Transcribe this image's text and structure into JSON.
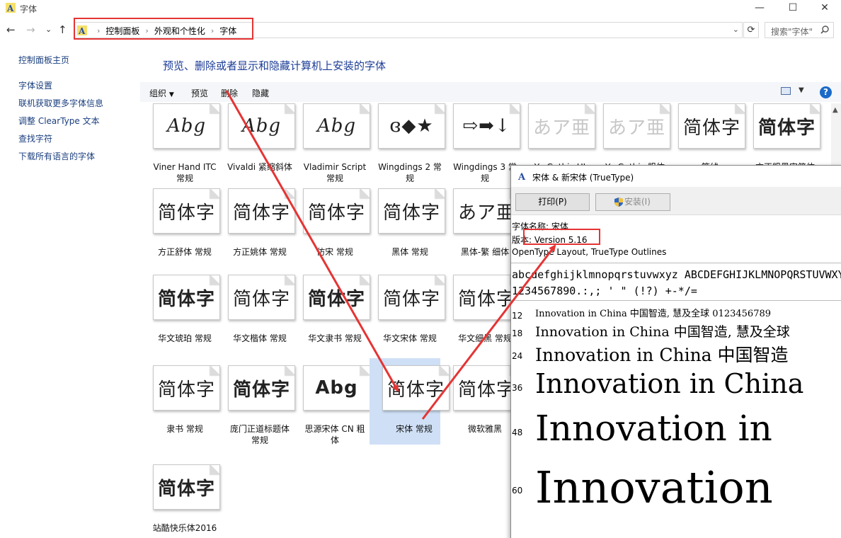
{
  "window": {
    "title": "字体",
    "min_glyph": "—",
    "max_glyph": "☐",
    "close_glyph": "✕"
  },
  "nav": {
    "back_glyph": "←",
    "forward_glyph": "→",
    "history_glyph": "⌄",
    "up_glyph": "↑"
  },
  "address": {
    "crumbs": [
      "控制面板",
      "外观和个性化",
      "字体"
    ],
    "sep_glyph": "›",
    "dropdown_glyph": "⌄",
    "refresh_glyph": "⟳"
  },
  "search": {
    "placeholder": "搜索\"字体\""
  },
  "sidebar": {
    "items": [
      {
        "label": "控制面板主页"
      },
      {
        "label": "字体设置"
      },
      {
        "label": "联机获取更多字体信息"
      },
      {
        "label": "调整 ClearType 文本"
      },
      {
        "label": "查找字符"
      },
      {
        "label": "下载所有语言的字体"
      }
    ]
  },
  "page_title": "预览、删除或者显示和隐藏计算机上安装的字体",
  "toolbar": {
    "organize": "组织",
    "organize_dd": "▼",
    "preview": "预览",
    "delete": "删除",
    "hide": "隐藏",
    "view_dd": "▼",
    "help": "?"
  },
  "fonts": [
    {
      "sample": "Abg",
      "style": "italic",
      "name": "Viner Hand ITC 常规"
    },
    {
      "sample": "Abg",
      "style": "italic",
      "name": "Vivaldi 紧缩斜体"
    },
    {
      "sample": "Abg",
      "style": "italic",
      "name": "Vladimir Script 常规"
    },
    {
      "sample": "ɞ◆★",
      "style": "normal",
      "name": "Wingdings 2 常规"
    },
    {
      "sample": "⇨➡↓",
      "style": "normal",
      "name": "Wingdings 3 常规"
    },
    {
      "sample": "あア亜",
      "style": "light",
      "name": "Yu Gothic UI"
    },
    {
      "sample": "あア亜",
      "style": "light",
      "name": "Yu Gothic 粗体"
    },
    {
      "sample": "简体字",
      "style": "normal",
      "name": "等线"
    },
    {
      "sample": "简体字",
      "style": "bold",
      "name": "方正粗黑宋简体"
    },
    {
      "sample": "简体字",
      "style": "normal",
      "name": "方正舒体 常规"
    },
    {
      "sample": "简体字",
      "style": "normal",
      "name": "方正姚体 常规"
    },
    {
      "sample": "简体字",
      "style": "normal",
      "name": "仿宋 常规"
    },
    {
      "sample": "简体字",
      "style": "normal",
      "name": "黑体 常规"
    },
    {
      "sample": "あア亜",
      "style": "normal",
      "name": "黑体-繁 细体"
    },
    {
      "sample": "简体字",
      "style": "bold",
      "name": "华文琥珀 常规"
    },
    {
      "sample": "简体字",
      "style": "normal",
      "name": "华文楷体 常规"
    },
    {
      "sample": "简体字",
      "style": "bold",
      "name": "华文隶书 常规"
    },
    {
      "sample": "简体字",
      "style": "normal",
      "name": "华文宋体 常规"
    },
    {
      "sample": "简体字",
      "style": "normal",
      "name": "华文细黑 常规"
    },
    {
      "sample": "简体字",
      "style": "normal",
      "name": "隶书 常规"
    },
    {
      "sample": "简体字",
      "style": "bold",
      "name": "庞门正道标题体 常规"
    },
    {
      "sample": "Abg",
      "style": "bold",
      "name": "思源宋体 CN 粗体"
    },
    {
      "sample": "简体字",
      "style": "normal",
      "name": "宋体 常规"
    },
    {
      "sample": "简体字",
      "style": "normal",
      "name": "微软雅黑"
    },
    {
      "sample": "简体字",
      "style": "bold",
      "name": "站酷快乐体2016"
    }
  ],
  "dialog": {
    "title": "宋体 & 新宋体 (TrueType)",
    "print": "打印(P)",
    "install": "安装(I)",
    "font_name": "字体名称: 宋体",
    "version": "版本: Version 5.16",
    "outline": "OpenType Layout, TrueType Outlines",
    "sample_line1": "abcdefghijklmnopqrstuvwxyz ABCDEFGHIJKLMNOPQRSTUVWXYZ",
    "sample_line2": "1234567890.:,; ' \" (!?) +-*/=",
    "sizes": [
      {
        "size": "12",
        "text": "Innovation in China 中国智造, 慧及全球 0123456789"
      },
      {
        "size": "18",
        "text": "Innovation in China 中国智造, 慧及全球"
      },
      {
        "size": "24",
        "text": "Innovation in China 中国智造"
      },
      {
        "size": "36",
        "text": "Innovation in China"
      },
      {
        "size": "48",
        "text": "Innovation in"
      },
      {
        "size": "60",
        "text": "Innovation"
      }
    ]
  },
  "colors": {
    "accent": "#1c3d97",
    "highlight": "#e53434",
    "selection": "#cfe0f6"
  },
  "icons": [
    "font-icon",
    "back-icon",
    "forward-icon",
    "up-icon",
    "refresh-icon",
    "search-icon",
    "help-icon",
    "view-icon",
    "shield-icon"
  ]
}
